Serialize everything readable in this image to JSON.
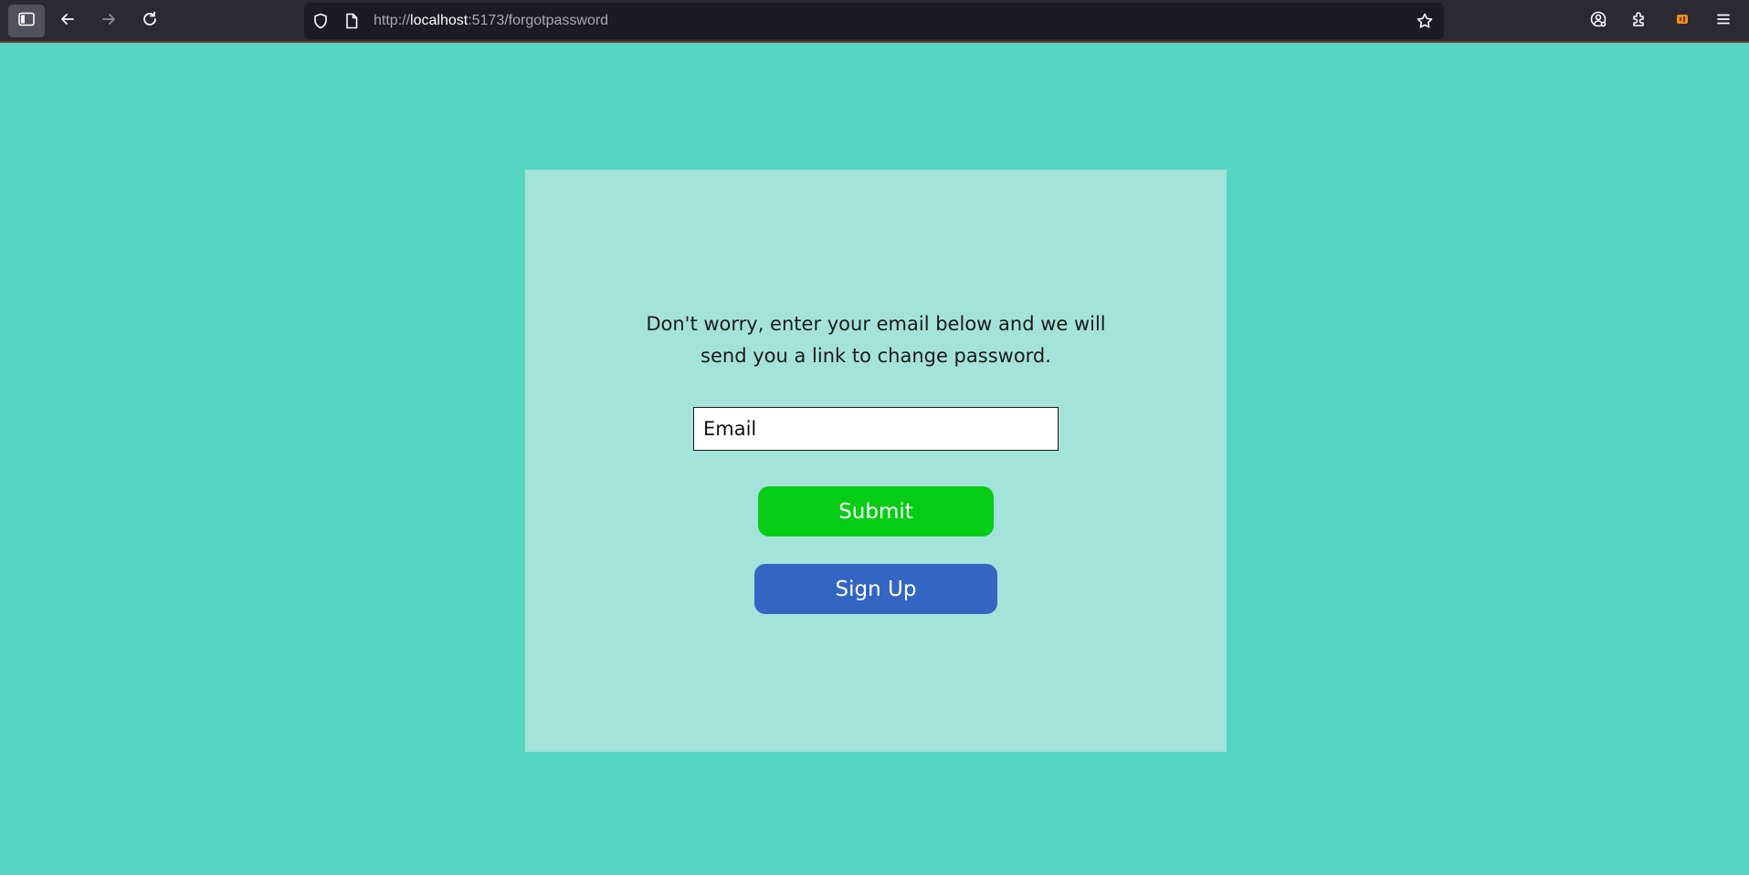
{
  "browser": {
    "url_prefix": "http://",
    "url_host": "localhost",
    "url_path": ":5173/forgotpassword",
    "icons": {
      "sidebar": "sidebar-icon",
      "back": "back-arrow-icon",
      "forward": "forward-arrow-icon",
      "reload": "reload-icon",
      "shield": "shield-icon",
      "page": "page-icon",
      "bookmark": "star-icon",
      "account": "account-icon",
      "extensions": "puzzle-icon",
      "extension_app": "extension-app-icon",
      "menu": "hamburger-menu-icon"
    }
  },
  "page": {
    "background_color": "#55d6c2",
    "card_color": "#a4e3da",
    "message": "Don't worry, enter your email below and we will send you a link to change password.",
    "email": {
      "placeholder": "Email",
      "value": ""
    },
    "submit_label": "Submit",
    "submit_color": "#05cc15",
    "signup_label": "Sign Up",
    "signup_color": "#3366c2"
  }
}
